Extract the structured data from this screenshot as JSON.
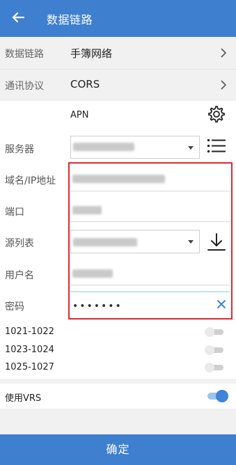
{
  "header": {
    "title": "数据链路",
    "back_icon": "arrow-left-icon"
  },
  "link_settings": {
    "data_link_label": "数据链路",
    "data_link_value": "手簿网络",
    "protocol_label": "通讯协议",
    "protocol_value": "CORS"
  },
  "apn": {
    "label": "APN",
    "settings_icon": "gear-icon"
  },
  "form": {
    "server_label": "服务器",
    "domain_label": "域名/IP地址",
    "port_label": "端口",
    "source_label": "源列表",
    "username_label": "用户名",
    "password_label": "密码",
    "password_mask": "•••••••"
  },
  "ports": [
    {
      "label": "1021-1022",
      "enabled": false
    },
    {
      "label": "1023-1024",
      "enabled": false
    },
    {
      "label": "1025-1027",
      "enabled": false
    }
  ],
  "vrs": {
    "label": "使用VRS",
    "enabled": true
  },
  "footer": {
    "confirm_label": "确定"
  },
  "colors": {
    "primary": "#3f7fcf",
    "highlight": "#e0282e",
    "toggle_on": "#3f84d8"
  }
}
